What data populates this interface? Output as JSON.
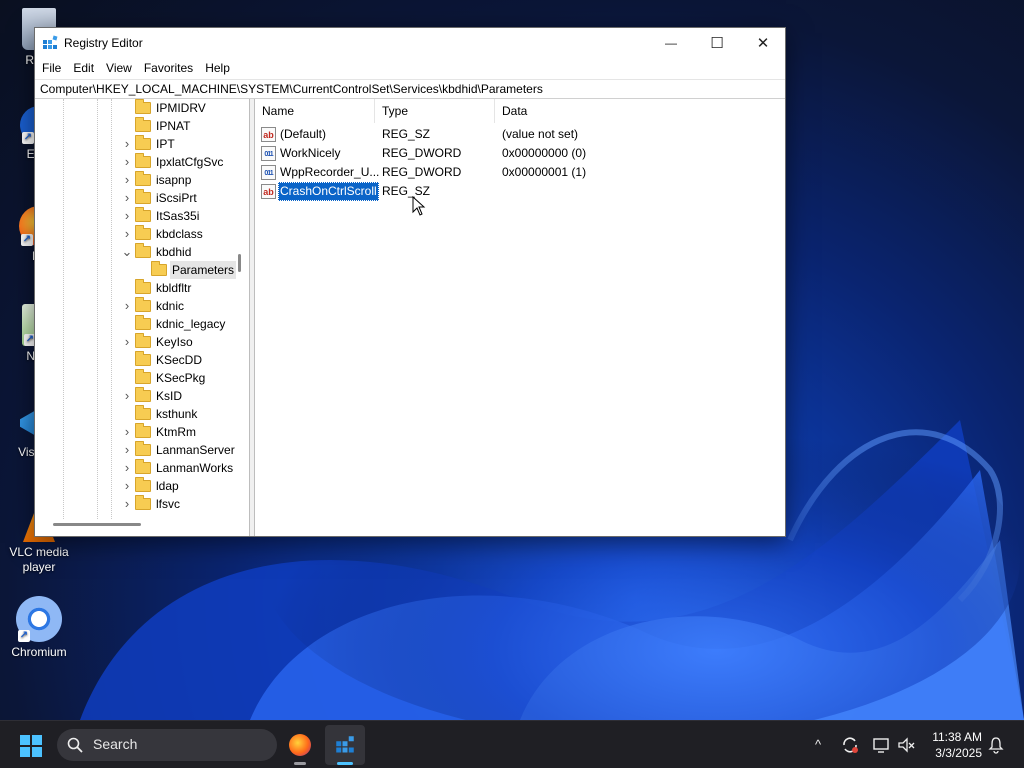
{
  "window": {
    "title": "Registry Editor",
    "minimize_glyph": "—",
    "maximize_glyph": "☐",
    "close_glyph": "✕"
  },
  "menu": [
    "File",
    "Edit",
    "View",
    "Favorites",
    "Help"
  ],
  "address": "Computer\\HKEY_LOCAL_MACHINE\\SYSTEM\\CurrentControlSet\\Services\\kbdhid\\Parameters",
  "tree": [
    {
      "label": "IPMIDRV",
      "expander": ""
    },
    {
      "label": "IPNAT",
      "expander": ""
    },
    {
      "label": "IPT",
      "expander": ">"
    },
    {
      "label": "IpxlatCfgSvc",
      "expander": ">"
    },
    {
      "label": "isapnp",
      "expander": ">"
    },
    {
      "label": "iScsiPrt",
      "expander": ">"
    },
    {
      "label": "ItSas35i",
      "expander": ">"
    },
    {
      "label": "kbdclass",
      "expander": ">"
    },
    {
      "label": "kbdhid",
      "expander": "v"
    },
    {
      "label": "Parameters",
      "expander": "",
      "child": true,
      "selected": true
    },
    {
      "label": "kbldfltr",
      "expander": ""
    },
    {
      "label": "kdnic",
      "expander": ">"
    },
    {
      "label": "kdnic_legacy",
      "expander": ""
    },
    {
      "label": "KeyIso",
      "expander": ">"
    },
    {
      "label": "KSecDD",
      "expander": ""
    },
    {
      "label": "KSecPkg",
      "expander": ""
    },
    {
      "label": "KsID",
      "expander": ">"
    },
    {
      "label": "ksthunk",
      "expander": ""
    },
    {
      "label": "KtmRm",
      "expander": ">"
    },
    {
      "label": "LanmanServer",
      "expander": ">"
    },
    {
      "label": "LanmanWorks",
      "expander": ">"
    },
    {
      "label": "ldap",
      "expander": ">"
    },
    {
      "label": "lfsvc",
      "expander": ">"
    }
  ],
  "columns": {
    "name": "Name",
    "type": "Type",
    "data": "Data"
  },
  "values": [
    {
      "name": "(Default)",
      "type": "REG_SZ",
      "data": "(value not set)",
      "icon": "ab"
    },
    {
      "name": "WorkNicely",
      "type": "REG_DWORD",
      "data": "0x00000000 (0)",
      "icon": "011"
    },
    {
      "name": "WppRecorder_U...",
      "type": "REG_DWORD",
      "data": "0x00000001 (1)",
      "icon": "011"
    },
    {
      "name": "CrashOnCtrlScroll",
      "type": "REG_SZ",
      "data": "",
      "icon": "ab",
      "selected": true
    }
  ],
  "desktop_icons": [
    {
      "label": "Recy",
      "icon": "recycle-bin-icon"
    },
    {
      "label": "Ever",
      "icon": "everything-icon"
    },
    {
      "label": "Fir",
      "icon": "firefox-icon"
    },
    {
      "label": "Note",
      "icon": "notepad-plus-icon"
    },
    {
      "label": "Visua C",
      "icon": "vscode-icon"
    },
    {
      "label": "VLC media player",
      "icon": "vlc-icon"
    },
    {
      "label": "Chromium",
      "icon": "chromium-icon"
    }
  ],
  "taskbar": {
    "search_label": "Search",
    "time": "11:38 AM",
    "date": "3/3/2025",
    "tray": {
      "overflow": "^"
    }
  },
  "colors": {
    "selection": "#0a64c8",
    "taskbar": "#1f1f24",
    "folder": "#f7cc52"
  }
}
